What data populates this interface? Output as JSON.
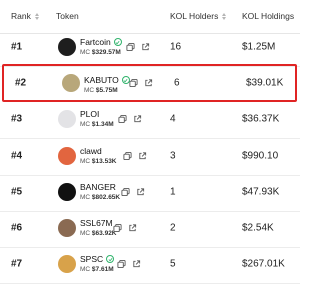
{
  "columns": {
    "rank": "Rank",
    "token": "Token",
    "kol_holders": "KOL Holders",
    "kol_holdings": "KOL Holdings"
  },
  "rows": [
    {
      "rank": "#1",
      "name": "Fartcoin",
      "mc_prefix": "MC",
      "mc_value": "$329.57M",
      "verified": true,
      "holders": "16",
      "holdings": "$1.25M",
      "avatar_color": "#1e1e1e"
    },
    {
      "rank": "#2",
      "name": "KABUTO",
      "mc_prefix": "MC",
      "mc_value": "$5.75M",
      "verified": true,
      "holders": "6",
      "holdings": "$39.01K",
      "avatar_color": "#b8a77a",
      "highlighted": true
    },
    {
      "rank": "#3",
      "name": "PLOI",
      "mc_prefix": "MC",
      "mc_value": "$1.34M",
      "verified": false,
      "holders": "4",
      "holdings": "$36.37K",
      "avatar_color": "#e3e3e6"
    },
    {
      "rank": "#4",
      "name": "clawd",
      "mc_prefix": "MC",
      "mc_value": "$13.53K",
      "verified": false,
      "holders": "3",
      "holdings": "$990.10",
      "avatar_color": "#e2653f"
    },
    {
      "rank": "#5",
      "name": "BANGER",
      "mc_prefix": "MC",
      "mc_value": "$802.65K",
      "verified": false,
      "holders": "1",
      "holdings": "$47.93K",
      "avatar_color": "#111111"
    },
    {
      "rank": "#6",
      "name": "SSL67M",
      "mc_prefix": "MC",
      "mc_value": "$63.92K",
      "verified": false,
      "holders": "2",
      "holdings": "$2.54K",
      "avatar_color": "#8a6a52"
    },
    {
      "rank": "#7",
      "name": "SPSC",
      "mc_prefix": "MC",
      "mc_value": "$7.61M",
      "verified": true,
      "holders": "5",
      "holdings": "$267.01K",
      "avatar_color": "#d8a24a"
    }
  ],
  "icons": {
    "copy": "copy-icon",
    "external": "external-link-icon",
    "verified": "verified-check-icon",
    "sort": "sort-arrows-icon"
  },
  "colors": {
    "highlight_border": "#e02424",
    "verified": "#2fb36b"
  }
}
